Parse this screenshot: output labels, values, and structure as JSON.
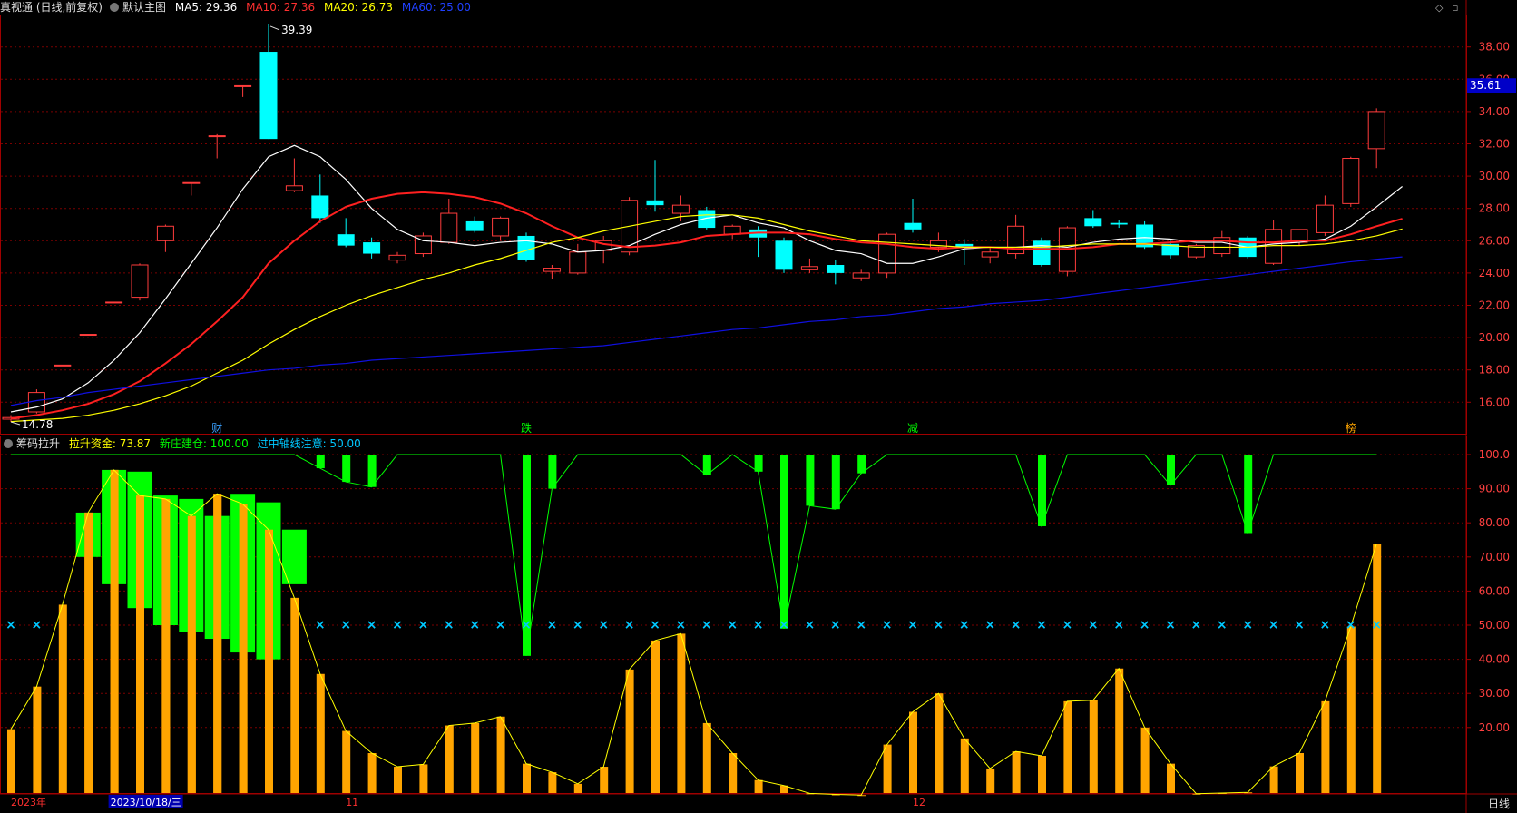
{
  "main_header": {
    "title": "真视通 (日线,前复权)",
    "template": "默认主图",
    "ma": [
      {
        "label": "MA5: 29.36",
        "color": "#ffffff"
      },
      {
        "label": "MA10: 27.36",
        "color": "#ff3030"
      },
      {
        "label": "MA20: 26.73",
        "color": "#ffff00"
      },
      {
        "label": "MA60: 25.00",
        "color": "#2020ff"
      }
    ]
  },
  "sub_header": {
    "title": "筹码拉升",
    "items": [
      {
        "label": "拉升资金: 73.87",
        "color": "#ffff00"
      },
      {
        "label": "新庄建仓: 100.00",
        "color": "#00ff00"
      },
      {
        "label": "过中轴线注意: 50.00",
        "color": "#00c8ff"
      }
    ]
  },
  "current_price_tag": "35.61",
  "footer": {
    "period_label": "日线"
  },
  "colors": {
    "up": "#ff3c3c",
    "down": "#00ffff",
    "orange": "#ffa500",
    "green": "#00ff00",
    "grid": "#7a0000"
  },
  "chart_data": [
    {
      "type": "candlestick",
      "yticks": [
        "38.00",
        "36.00",
        "34.00",
        "32.00",
        "30.00",
        "28.00",
        "26.00",
        "24.00",
        "22.00",
        "20.00",
        "18.00",
        "16.00"
      ],
      "ylim": [
        14.5,
        39.5
      ],
      "high_label": "39.39",
      "low_label": "14.78",
      "candles": [
        {
          "o": 14.95,
          "h": 15.2,
          "l": 14.78,
          "c": 15.05
        },
        {
          "o": 15.4,
          "h": 16.8,
          "l": 15.3,
          "c": 16.6
        },
        {
          "o": 18.3,
          "h": 18.3,
          "l": 18.3,
          "c": 18.3
        },
        {
          "o": 20.2,
          "h": 20.2,
          "l": 20.2,
          "c": 20.2
        },
        {
          "o": 22.2,
          "h": 22.2,
          "l": 22.2,
          "c": 22.2
        },
        {
          "o": 22.5,
          "h": 24.6,
          "l": 22.3,
          "c": 24.5
        },
        {
          "o": 26.0,
          "h": 27.0,
          "l": 25.3,
          "c": 26.9
        },
        {
          "o": 29.6,
          "h": 29.6,
          "l": 28.8,
          "c": 29.6
        },
        {
          "o": 32.5,
          "h": 32.6,
          "l": 31.1,
          "c": 32.5
        },
        {
          "o": 35.6,
          "h": 35.6,
          "l": 34.9,
          "c": 35.6
        },
        {
          "o": 37.7,
          "h": 39.39,
          "l": 32.3,
          "c": 32.3
        },
        {
          "o": 29.1,
          "h": 31.1,
          "l": 29.0,
          "c": 29.4
        },
        {
          "o": 28.8,
          "h": 30.1,
          "l": 27.1,
          "c": 27.4
        },
        {
          "o": 26.4,
          "h": 27.4,
          "l": 25.6,
          "c": 25.7
        },
        {
          "o": 25.9,
          "h": 26.2,
          "l": 24.9,
          "c": 25.2
        },
        {
          "o": 24.8,
          "h": 25.3,
          "l": 24.6,
          "c": 25.1
        },
        {
          "o": 25.2,
          "h": 26.5,
          "l": 25.0,
          "c": 26.3
        },
        {
          "o": 25.9,
          "h": 28.6,
          "l": 25.8,
          "c": 27.7
        },
        {
          "o": 27.2,
          "h": 27.5,
          "l": 26.5,
          "c": 26.6
        },
        {
          "o": 26.3,
          "h": 27.5,
          "l": 26.0,
          "c": 27.4
        },
        {
          "o": 26.3,
          "h": 26.5,
          "l": 24.7,
          "c": 24.8
        },
        {
          "o": 24.1,
          "h": 24.5,
          "l": 23.6,
          "c": 24.3
        },
        {
          "o": 24.0,
          "h": 25.8,
          "l": 23.9,
          "c": 25.3
        },
        {
          "o": 25.4,
          "h": 26.3,
          "l": 24.6,
          "c": 26.0
        },
        {
          "o": 25.3,
          "h": 28.7,
          "l": 25.1,
          "c": 28.5
        },
        {
          "o": 28.5,
          "h": 31.0,
          "l": 27.8,
          "c": 28.2
        },
        {
          "o": 27.7,
          "h": 28.8,
          "l": 27.2,
          "c": 28.2
        },
        {
          "o": 27.9,
          "h": 28.1,
          "l": 26.7,
          "c": 26.8
        },
        {
          "o": 26.4,
          "h": 27.0,
          "l": 26.1,
          "c": 26.9
        },
        {
          "o": 26.7,
          "h": 26.9,
          "l": 25.0,
          "c": 26.2
        },
        {
          "o": 26.0,
          "h": 26.2,
          "l": 24.0,
          "c": 24.2
        },
        {
          "o": 24.2,
          "h": 24.9,
          "l": 24.0,
          "c": 24.4
        },
        {
          "o": 24.5,
          "h": 24.8,
          "l": 23.3,
          "c": 24.0
        },
        {
          "o": 23.7,
          "h": 24.2,
          "l": 23.5,
          "c": 24.0
        },
        {
          "o": 24.0,
          "h": 26.5,
          "l": 23.7,
          "c": 26.4
        },
        {
          "o": 27.1,
          "h": 28.6,
          "l": 26.5,
          "c": 26.7
        },
        {
          "o": 25.6,
          "h": 26.5,
          "l": 25.3,
          "c": 26.0
        },
        {
          "o": 25.8,
          "h": 26.1,
          "l": 24.5,
          "c": 25.6
        },
        {
          "o": 25.0,
          "h": 25.6,
          "l": 24.6,
          "c": 25.3
        },
        {
          "o": 25.2,
          "h": 27.6,
          "l": 24.9,
          "c": 26.9
        },
        {
          "o": 26.0,
          "h": 26.2,
          "l": 24.4,
          "c": 24.5
        },
        {
          "o": 24.1,
          "h": 26.9,
          "l": 23.8,
          "c": 26.8
        },
        {
          "o": 27.4,
          "h": 27.9,
          "l": 26.8,
          "c": 26.9
        },
        {
          "o": 27.1,
          "h": 27.3,
          "l": 26.8,
          "c": 27.0
        },
        {
          "o": 27.0,
          "h": 27.2,
          "l": 25.5,
          "c": 25.6
        },
        {
          "o": 25.8,
          "h": 26.0,
          "l": 24.9,
          "c": 25.1
        },
        {
          "o": 25.0,
          "h": 25.8,
          "l": 24.9,
          "c": 25.7
        },
        {
          "o": 25.2,
          "h": 26.6,
          "l": 25.0,
          "c": 26.2
        },
        {
          "o": 26.2,
          "h": 26.3,
          "l": 24.9,
          "c": 25.0
        },
        {
          "o": 24.6,
          "h": 27.3,
          "l": 24.5,
          "c": 26.7
        },
        {
          "o": 25.9,
          "h": 26.7,
          "l": 25.7,
          "c": 26.7
        },
        {
          "o": 26.5,
          "h": 28.8,
          "l": 26.3,
          "c": 28.2
        },
        {
          "o": 28.3,
          "h": 31.2,
          "l": 28.1,
          "c": 31.1
        },
        {
          "o": 31.7,
          "h": 34.2,
          "l": 30.5,
          "c": 34.0
        }
      ],
      "series": [
        {
          "name": "MA5",
          "color": "#ffffff",
          "values": [
            15.4,
            15.7,
            16.2,
            17.2,
            18.6,
            20.3,
            22.4,
            24.6,
            26.8,
            29.2,
            31.2,
            31.9,
            31.2,
            29.8,
            28.0,
            26.7,
            26.0,
            25.9,
            25.7,
            25.9,
            26.0,
            25.8,
            25.3,
            25.4,
            25.7,
            26.4,
            27.0,
            27.4,
            27.6,
            27.1,
            26.8,
            26.0,
            25.4,
            25.2,
            24.6,
            24.6,
            25.0,
            25.5,
            25.6,
            25.6,
            25.7,
            25.6,
            25.9,
            26.1,
            26.2,
            26.1,
            25.9,
            25.9,
            25.6,
            25.8,
            25.9,
            26.1,
            26.9,
            28.1,
            29.36
          ]
        },
        {
          "name": "MA10",
          "color": "#ff2020",
          "values": [
            15.0,
            15.2,
            15.5,
            15.9,
            16.5,
            17.3,
            18.4,
            19.6,
            21.0,
            22.5,
            24.6,
            26.0,
            27.2,
            28.1,
            28.6,
            28.9,
            29.0,
            28.9,
            28.7,
            28.3,
            27.7,
            26.9,
            26.2,
            25.8,
            25.6,
            25.7,
            25.9,
            26.3,
            26.4,
            26.5,
            26.5,
            26.4,
            26.1,
            25.9,
            25.8,
            25.6,
            25.5,
            25.6,
            25.6,
            25.5,
            25.5,
            25.5,
            25.6,
            25.8,
            25.8,
            25.9,
            26.0,
            26.0,
            25.9,
            25.9,
            26.0,
            26.0,
            26.4,
            26.9,
            27.36
          ]
        },
        {
          "name": "MA20",
          "color": "#ffff00",
          "values": [
            14.8,
            14.9,
            15.0,
            15.2,
            15.5,
            15.9,
            16.4,
            17.0,
            17.8,
            18.6,
            19.6,
            20.5,
            21.3,
            22.0,
            22.6,
            23.1,
            23.6,
            24.0,
            24.5,
            24.9,
            25.4,
            25.9,
            26.2,
            26.6,
            26.9,
            27.2,
            27.5,
            27.6,
            27.6,
            27.4,
            27.0,
            26.6,
            26.3,
            26.0,
            25.9,
            25.8,
            25.7,
            25.6,
            25.6,
            25.6,
            25.6,
            25.7,
            25.8,
            25.8,
            25.8,
            25.7,
            25.6,
            25.6,
            25.6,
            25.7,
            25.7,
            25.8,
            26.0,
            26.3,
            26.73
          ]
        },
        {
          "name": "MA60",
          "color": "#1010e0",
          "values": [
            15.8,
            16.1,
            16.3,
            16.6,
            16.8,
            17.0,
            17.2,
            17.4,
            17.6,
            17.8,
            18.0,
            18.1,
            18.3,
            18.4,
            18.6,
            18.7,
            18.8,
            18.9,
            19.0,
            19.1,
            19.2,
            19.3,
            19.4,
            19.5,
            19.7,
            19.9,
            20.1,
            20.3,
            20.5,
            20.6,
            20.8,
            21.0,
            21.1,
            21.3,
            21.4,
            21.6,
            21.8,
            21.9,
            22.1,
            22.2,
            22.3,
            22.5,
            22.7,
            22.9,
            23.1,
            23.3,
            23.5,
            23.7,
            23.9,
            24.1,
            24.3,
            24.5,
            24.7,
            24.85,
            25.0
          ]
        }
      ],
      "event_markers": [
        {
          "index": 8,
          "label": "财",
          "color": "#3aa0ff"
        },
        {
          "index": 20,
          "label": "跌",
          "color": "#00ff00"
        },
        {
          "index": 35,
          "label": "减",
          "color": "#00ff00"
        },
        {
          "index": 52,
          "label": "榜",
          "color": "#ffa500"
        }
      ]
    },
    {
      "type": "bar",
      "yticks": [
        "100.0",
        "90.00",
        "80.00",
        "70.00",
        "60.00",
        "50.00",
        "40.00",
        "30.00",
        "20.00"
      ],
      "ylim": [
        0,
        103
      ],
      "series": [
        {
          "name": "拉升资金",
          "color": "#ffa500",
          "values": [
            19.5,
            32,
            56,
            83,
            95.5,
            88,
            87,
            82,
            88.5,
            85.5,
            78,
            58,
            35.7,
            19,
            12.5,
            8.5,
            9.2,
            20.6,
            21.3,
            23.2,
            9.4,
            6.9,
            3.5,
            8.5,
            37,
            45.5,
            47.5,
            21.3,
            12.5,
            4.6,
            3,
            0.7,
            0.4,
            0.2,
            15,
            24.6,
            30,
            16.8,
            8,
            13,
            11.7,
            27.7,
            28,
            37.3,
            20,
            9.4,
            0.6,
            0.8,
            1,
            8.6,
            12.5,
            27.7,
            49.6,
            73.87
          ]
        },
        {
          "name": "新庄建仓",
          "color": "#00ff00",
          "values": [
            100,
            100,
            100,
            100,
            100,
            100,
            100,
            100,
            100,
            100,
            100,
            100,
            96,
            92,
            90.5,
            100,
            100,
            100,
            100,
            100,
            41,
            90,
            100,
            100,
            100,
            100,
            100,
            94,
            100,
            95,
            49,
            85,
            84,
            94.5,
            100,
            100,
            100,
            100,
            100,
            100,
            79,
            100,
            100,
            100,
            100,
            91,
            100,
            100,
            77,
            100,
            100,
            100,
            100,
            100
          ]
        },
        {
          "name": "过中轴线注意",
          "color": "#00c8ff",
          "values": [
            50,
            50,
            50,
            50,
            50,
            50,
            50,
            50,
            50,
            50,
            50,
            50,
            50,
            50,
            50,
            50,
            50,
            50,
            50,
            50,
            50,
            50,
            50,
            50,
            50,
            50,
            50,
            50,
            50,
            50,
            50,
            50,
            50,
            50,
            50,
            50,
            50,
            50,
            50,
            50,
            50,
            50,
            50,
            50,
            50,
            50,
            50,
            50,
            50,
            50,
            50,
            50,
            50,
            50
          ]
        }
      ],
      "green_blocks": [
        {
          "index": 3,
          "from": 70,
          "to": 83
        },
        {
          "index": 4,
          "from": 62,
          "to": 95.5
        },
        {
          "index": 5,
          "from": 55,
          "to": 95
        },
        {
          "index": 6,
          "from": 50,
          "to": 88
        },
        {
          "index": 7,
          "from": 48,
          "to": 87
        },
        {
          "index": 8,
          "from": 46,
          "to": 82
        },
        {
          "index": 9,
          "from": 42,
          "to": 88.5
        },
        {
          "index": 10,
          "from": 40,
          "to": 86
        },
        {
          "index": 11,
          "from": 62,
          "to": 78
        }
      ],
      "xlabels": [
        {
          "index": 0,
          "label": "2023年",
          "color": "#ff3030"
        },
        {
          "index": 4,
          "label": "2023/10/18/三",
          "color": "#ffffff",
          "highlight": true
        },
        {
          "index": 13,
          "label": "11",
          "color": "#ff3030"
        },
        {
          "index": 35,
          "label": "12",
          "color": "#ff3030"
        }
      ]
    }
  ]
}
